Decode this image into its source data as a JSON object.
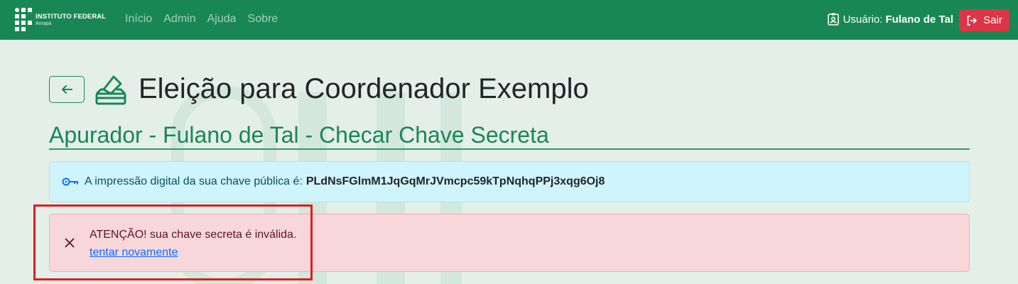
{
  "brand": {
    "name": "INSTITUTO FEDERAL",
    "campus": "Amapá"
  },
  "nav": {
    "items": [
      {
        "label": "Início"
      },
      {
        "label": "Admin"
      },
      {
        "label": "Ajuda"
      },
      {
        "label": "Sobre"
      }
    ]
  },
  "user": {
    "prefix": "Usuário:",
    "name": "Fulano de Tal"
  },
  "logout": {
    "label": "Sair"
  },
  "page": {
    "title": "Eleição para Coordenador Exemplo",
    "subtitle": "Apurador - Fulano de Tal - Checar Chave Secreta"
  },
  "info_alert": {
    "text": "A impressão digital da sua chave pública é:",
    "fingerprint": "PLdNsFGlmM1JqGqMrJVmcpc59kTpNqhqPPj3xqg6Oj8"
  },
  "danger_alert": {
    "message": "ATENÇÃO! sua chave secreta é inválida.",
    "link": "tentar novamente"
  },
  "colors": {
    "primary": "#198754",
    "danger": "#dc3545",
    "info_bg": "#cff4fc",
    "danger_bg": "#f8d7da",
    "highlight": "#e11d1d"
  },
  "icons": {
    "brand": "if-logo-icon",
    "user": "user-badge-icon",
    "logout": "logout-icon",
    "back": "arrow-left-icon",
    "title": "ballot-box-icon",
    "key": "key-icon",
    "close": "close-icon"
  }
}
